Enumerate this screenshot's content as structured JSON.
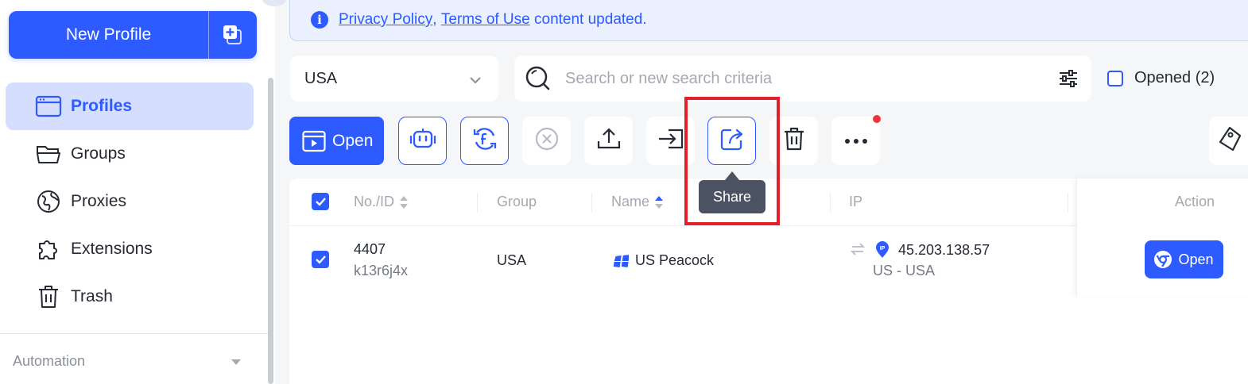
{
  "sidebar": {
    "new_profile_label": "New Profile",
    "items": [
      {
        "label": "Profiles",
        "icon": "browser-window-icon",
        "active": true
      },
      {
        "label": "Groups",
        "icon": "folder-open-icon",
        "active": false
      },
      {
        "label": "Proxies",
        "icon": "globe-icon",
        "active": false
      },
      {
        "label": "Extensions",
        "icon": "puzzle-icon",
        "active": false
      },
      {
        "label": "Trash",
        "icon": "trash-icon",
        "active": false
      }
    ],
    "automation_label": "Automation"
  },
  "notice": {
    "privacy_link": "Privacy Policy",
    "separator": ",",
    "terms_link": "Terms of Use",
    "text": "content updated."
  },
  "filters": {
    "group_value": "USA",
    "search_placeholder": "Search or new search criteria",
    "opened_label": "Opened (2)"
  },
  "toolbar": {
    "open_label": "Open",
    "buttons": [
      "robot-icon",
      "sync-icon",
      "close-circle-icon",
      "upload-icon",
      "import-icon",
      "share-icon",
      "trash-icon",
      "more-icon",
      "tag-icon"
    ],
    "tooltip": "Share"
  },
  "table": {
    "columns": {
      "no_id": "No./ID",
      "group": "Group",
      "name": "Name",
      "ip": "IP",
      "action": "Action"
    },
    "rows": [
      {
        "no": "4407",
        "id": "k13r6j4x",
        "group": "USA",
        "name": "US Peacock",
        "ip": "45.203.138.57",
        "location": "US - USA",
        "action_label": "Open"
      }
    ]
  },
  "colors": {
    "primary": "#2e5bff",
    "active_bg": "#d5defe",
    "highlight": "#e3202a",
    "tooltip_bg": "#4b5261",
    "notification": "#f5323c"
  }
}
